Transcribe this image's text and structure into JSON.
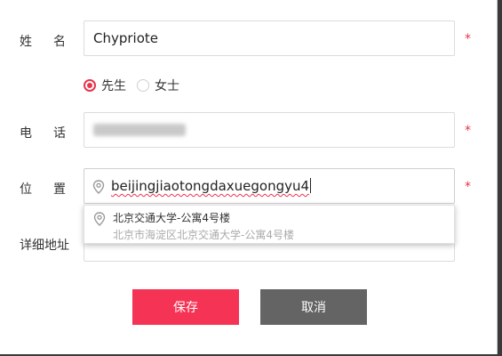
{
  "form": {
    "name": {
      "label": "姓名",
      "chars": [
        "姓",
        "名"
      ],
      "value": "Chypriote",
      "required": "*"
    },
    "gender": {
      "options": [
        {
          "label": "先生",
          "checked": true
        },
        {
          "label": "女士",
          "checked": false
        }
      ]
    },
    "phone": {
      "chars": [
        "电",
        "话"
      ],
      "required": "*"
    },
    "location": {
      "chars": [
        "位",
        "置"
      ],
      "value": "beijingjiaotongdaxuegongyu4",
      "required": "*"
    },
    "address_detail": {
      "label": "详细地址"
    }
  },
  "suggestion": {
    "title": "北京交通大学-公寓4号楼",
    "subtitle": "北京市海淀区北京交通大学-公寓4号楼"
  },
  "buttons": {
    "save": "保存",
    "cancel": "取消"
  },
  "colors": {
    "accent": "#f53354",
    "cancel_bg": "#646464",
    "required": "#e8344d"
  }
}
